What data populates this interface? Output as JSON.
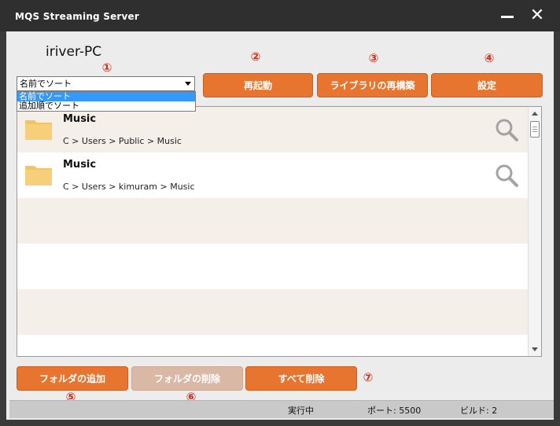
{
  "window": {
    "title": "MQS Streaming Server",
    "minimize_label": "—",
    "close_label": "✕"
  },
  "server": {
    "pc_name": "iriver-PC"
  },
  "sort": {
    "selected": "名前でソート",
    "options": [
      "名前でソート",
      "追加順でソート"
    ]
  },
  "badges": [
    "①",
    "②",
    "③",
    "④",
    "⑤",
    "⑥",
    "⑦"
  ],
  "toolbar": {
    "restart_label": "再起動",
    "rebuild_label": "ライブラリの再構築",
    "settings_label": "設定"
  },
  "folders": [
    {
      "name": "Music",
      "path": "C > Users > Public > Music"
    },
    {
      "name": "Music",
      "path": "C > Users > kimuram > Music"
    }
  ],
  "actions": {
    "add_label": "フォルダの追加",
    "delete_label": "フォルダの削除",
    "delete_all_label": "すべて削除",
    "delete_enabled": false
  },
  "status": {
    "state": "実行中",
    "port": "ポート: 5500",
    "build": "ビルド: 2"
  },
  "colors": {
    "accent": "#e8752f",
    "accent_disabled": "#d9b8a6",
    "badge": "#d02d1a",
    "folder": "#f7cf7a",
    "row_alt": "#f5efea",
    "titlebar": "#2f2f2f"
  }
}
